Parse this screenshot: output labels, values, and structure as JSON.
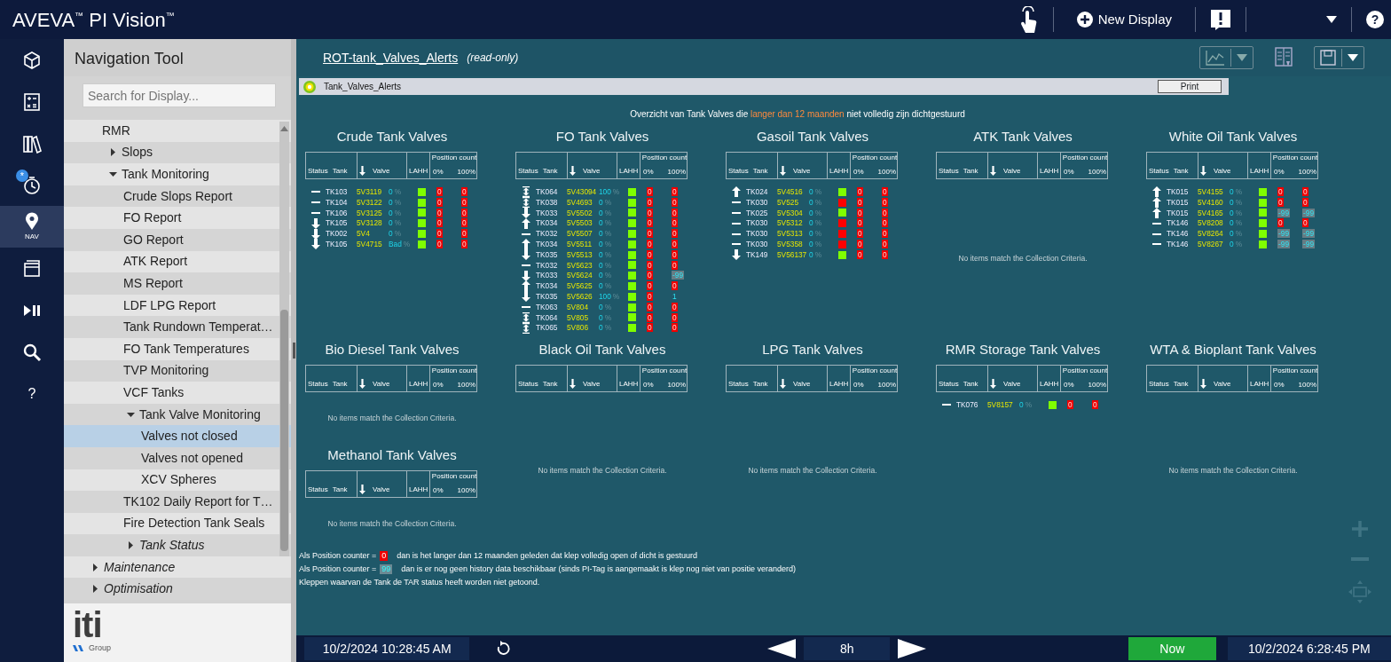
{
  "app": {
    "title": "AVEVA$^{™}$ PI Vision$^{™}$",
    "new_display": "New Display",
    "help": "?"
  },
  "rail": [
    {
      "kind": "cube",
      "selected": false
    },
    {
      "kind": "calculator",
      "selected": false
    },
    {
      "kind": "library",
      "selected": false
    },
    {
      "kind": "clock",
      "badge": "*",
      "selected": false
    },
    {
      "kind": "nav",
      "label": "NAV",
      "selected": true
    },
    {
      "kind": "screens",
      "selected": false
    },
    {
      "kind": "play",
      "selected": false
    },
    {
      "kind": "search",
      "selected": false
    },
    {
      "kind": "help",
      "label": "?",
      "selected": false
    }
  ],
  "navigation": {
    "title": "Navigation Tool",
    "search": {
      "placeholder": "Search for Display..."
    },
    "tree": [
      {
        "label": "RMR",
        "kind": "folder",
        "selected": false,
        "children": [
          {
            "label": "Slops",
            "kind": "folder",
            "expanded": false,
            "selected": false
          },
          {
            "label": "Tank Monitoring",
            "kind": "folder",
            "expanded": true,
            "selected": false,
            "children": [
              {
                "label": "Crude Slops Report",
                "kind": "display",
                "selected": false
              },
              {
                "label": "FO Report",
                "kind": "display",
                "selected": false
              },
              {
                "label": "GO Report",
                "kind": "display",
                "selected": false
              },
              {
                "label": "ATK Report",
                "kind": "display",
                "selected": false
              },
              {
                "label": "MS Report",
                "kind": "display",
                "selected": false
              },
              {
                "label": "LDF LPG Report",
                "kind": "display",
                "selected": false
              },
              {
                "label": "Tank Rundown Temperat…",
                "kind": "display",
                "selected": false
              },
              {
                "label": "FO Tank Temperatures",
                "kind": "display",
                "selected": false
              },
              {
                "label": "TVP Monitoring",
                "kind": "display",
                "selected": false
              },
              {
                "label": "VCF Tanks",
                "kind": "display",
                "selected": false
              },
              {
                "label": "Tank Valve Monitoring",
                "kind": "folder",
                "expanded": true,
                "selected": false,
                "children": [
                  {
                    "label": "Valves not closed",
                    "kind": "display",
                    "selected": true
                  },
                  {
                    "label": "Valves not opened",
                    "kind": "display",
                    "selected": false
                  },
                  {
                    "label": "XCV Spheres",
                    "kind": "display",
                    "selected": false
                  }
                ]
              },
              {
                "label": "TK102 Daily Report for T…",
                "kind": "display",
                "selected": false
              },
              {
                "label": "Fire Detection Tank Seals",
                "kind": "display",
                "selected": false
              },
              {
                "label": "Tank Status",
                "kind": "category",
                "expanded": false,
                "selected": false
              }
            ]
          }
        ]
      },
      {
        "label": "Maintenance",
        "kind": "category",
        "expanded": false,
        "selected": false
      },
      {
        "label": "Optimisation",
        "kind": "category",
        "expanded": false,
        "selected": false
      }
    ],
    "logo": "iti",
    "logo_sub": "Group"
  },
  "display_header": {
    "name": "ROT-tank_Valves_Alerts",
    "mode": "(read-only)"
  },
  "display_bar": {
    "title": "Tank_Valves_Alerts",
    "print": "Print"
  },
  "headline": {
    "before": "Overzicht van Tank Valves die",
    "highlight": "langer dan 12 maanden",
    "after": "niet volledig zijn dichtgestuurd"
  },
  "panels": [
    {
      "title": "Crude Tank Valves",
      "header": {
        "status": "Status",
        "tank": "Tank",
        "valve": "Valve",
        "lahh": "LAHH",
        "group": "Position count",
        "low": "0%",
        "high": "100%"
      },
      "rows": [
        {
          "kind": "none",
          "tank": "TK103",
          "valve": "5V3119",
          "value": "0",
          "unit": "%",
          "lahh_alarm": false,
          "counts": [
            {
              "text": "0",
              "kind": "alarm"
            },
            {
              "text": "0",
              "kind": "alarm"
            }
          ]
        },
        {
          "kind": "none",
          "tank": "TK104",
          "valve": "5V3122",
          "value": "0",
          "unit": "%",
          "lahh_alarm": false,
          "counts": [
            {
              "text": "0",
              "kind": "alarm"
            },
            {
              "text": "0",
              "kind": "alarm"
            }
          ]
        },
        {
          "kind": "none",
          "tank": "TK106",
          "valve": "5V3125",
          "value": "0",
          "unit": "%",
          "lahh_alarm": false,
          "counts": [
            {
              "text": "0",
              "kind": "alarm"
            },
            {
              "text": "0",
              "kind": "alarm"
            }
          ]
        },
        {
          "kind": "down",
          "tank": "TK105",
          "valve": "5V3128",
          "value": "0",
          "unit": "%",
          "lahh_alarm": false,
          "counts": [
            {
              "text": "0",
              "kind": "alarm"
            },
            {
              "text": "0",
              "kind": "alarm"
            }
          ]
        },
        {
          "kind": "down",
          "tank": "TK002",
          "valve": "5V4",
          "value": "0",
          "unit": "%",
          "lahh_alarm": false,
          "counts": [
            {
              "text": "0",
              "kind": "alarm"
            },
            {
              "text": "0",
              "kind": "alarm"
            }
          ]
        },
        {
          "kind": "down",
          "tank": "TK105",
          "valve": "5V4715",
          "value": "Bad",
          "unit": "%",
          "lahh_alarm": false,
          "counts": [
            {
              "text": "0",
              "kind": "alarm"
            },
            {
              "text": "0",
              "kind": "alarm"
            }
          ]
        }
      ]
    },
    {
      "title": "FO Tank Valves",
      "header": {
        "status": "Status",
        "tank": "Tank",
        "valve": "Valve",
        "lahh": "LAHH",
        "group": "Position count",
        "low": "0%",
        "high": "100%"
      },
      "rows": [
        {
          "kind": "both",
          "tank": "TK064",
          "valve": "5V43094",
          "value": "100",
          "unit": "%",
          "lahh_alarm": false,
          "counts": [
            {
              "text": "0",
              "kind": "alarm"
            },
            {
              "text": "0",
              "kind": "alarm"
            }
          ]
        },
        {
          "kind": "both",
          "tank": "TK038",
          "valve": "5V4693",
          "value": "0",
          "unit": "%",
          "lahh_alarm": false,
          "counts": [
            {
              "text": "0",
              "kind": "alarm"
            },
            {
              "text": "0",
              "kind": "alarm"
            }
          ]
        },
        {
          "kind": "down",
          "tank": "TK033",
          "valve": "5V5502",
          "value": "0",
          "unit": "%",
          "lahh_alarm": false,
          "counts": [
            {
              "text": "0",
              "kind": "alarm"
            },
            {
              "text": "0",
              "kind": "alarm"
            }
          ]
        },
        {
          "kind": "up",
          "tank": "TK034",
          "valve": "5V5503",
          "value": "0",
          "unit": "%",
          "lahh_alarm": false,
          "counts": [
            {
              "text": "0",
              "kind": "alarm"
            },
            {
              "text": "0",
              "kind": "alarm"
            }
          ]
        },
        {
          "kind": "none",
          "tank": "TK032",
          "valve": "5V5507",
          "value": "0",
          "unit": "%",
          "lahh_alarm": false,
          "counts": [
            {
              "text": "0",
              "kind": "alarm"
            },
            {
              "text": "0",
              "kind": "alarm"
            }
          ]
        },
        {
          "kind": "up",
          "tank": "TK034",
          "valve": "5V5511",
          "value": "0",
          "unit": "%",
          "lahh_alarm": false,
          "counts": [
            {
              "text": "0",
              "kind": "alarm"
            },
            {
              "text": "0",
              "kind": "alarm"
            }
          ]
        },
        {
          "kind": "down",
          "tank": "TK035",
          "valve": "5V5513",
          "value": "0",
          "unit": "%",
          "lahh_alarm": false,
          "counts": [
            {
              "text": "0",
              "kind": "alarm"
            },
            {
              "text": "0",
              "kind": "alarm"
            }
          ]
        },
        {
          "kind": "none",
          "tank": "TK032",
          "valve": "5V5623",
          "value": "0",
          "unit": "%",
          "lahh_alarm": false,
          "counts": [
            {
              "text": "0",
              "kind": "alarm"
            },
            {
              "text": "0",
              "kind": "alarm"
            }
          ]
        },
        {
          "kind": "down",
          "tank": "TK033",
          "valve": "5V5624",
          "value": "0",
          "unit": "%",
          "lahh_alarm": false,
          "counts": [
            {
              "text": "0",
              "kind": "alarm"
            },
            {
              "text": "-99",
              "kind": "nodata"
            }
          ]
        },
        {
          "kind": "up",
          "tank": "TK034",
          "valve": "5V5625",
          "value": "0",
          "unit": "%",
          "lahh_alarm": false,
          "counts": [
            {
              "text": "0",
              "kind": "alarm"
            },
            {
              "text": "0",
              "kind": "alarm"
            }
          ]
        },
        {
          "kind": "down",
          "tank": "TK035",
          "valve": "5V5626",
          "value": "100",
          "unit": "%",
          "lahh_alarm": false,
          "counts": [
            {
              "text": "0",
              "kind": "alarm"
            },
            {
              "text": "1",
              "kind": "plain"
            }
          ]
        },
        {
          "kind": "none",
          "tank": "TK063",
          "valve": "5V804",
          "value": "0",
          "unit": "%",
          "lahh_alarm": false,
          "counts": [
            {
              "text": "0",
              "kind": "alarm"
            },
            {
              "text": "0",
              "kind": "alarm"
            }
          ]
        },
        {
          "kind": "both",
          "tank": "TK064",
          "valve": "5V805",
          "value": "0",
          "unit": "%",
          "lahh_alarm": false,
          "counts": [
            {
              "text": "0",
              "kind": "alarm"
            },
            {
              "text": "0",
              "kind": "alarm"
            }
          ]
        },
        {
          "kind": "both",
          "tank": "TK065",
          "valve": "5V806",
          "value": "0",
          "unit": "%",
          "lahh_alarm": false,
          "counts": [
            {
              "text": "0",
              "kind": "alarm"
            },
            {
              "text": "0",
              "kind": "alarm"
            }
          ]
        }
      ]
    },
    {
      "title": "Gasoil Tank Valves",
      "header": {
        "status": "Status",
        "tank": "Tank",
        "valve": "Valve",
        "lahh": "LAHH",
        "group": "Position count",
        "low": "0%",
        "high": "100%"
      },
      "rows": [
        {
          "kind": "up",
          "tank": "TK024",
          "valve": "5V4516",
          "value": "0",
          "unit": "%",
          "lahh_alarm": false,
          "counts": [
            {
              "text": "0",
              "kind": "alarm"
            },
            {
              "text": "0",
              "kind": "alarm"
            }
          ]
        },
        {
          "kind": "none",
          "tank": "TK030",
          "valve": "5V525",
          "value": "0",
          "unit": "%",
          "lahh_alarm": true,
          "counts": [
            {
              "text": "0",
              "kind": "alarm"
            },
            {
              "text": "0",
              "kind": "alarm"
            }
          ]
        },
        {
          "kind": "none",
          "tank": "TK025",
          "valve": "5V5304",
          "value": "0",
          "unit": "%",
          "lahh_alarm": false,
          "counts": [
            {
              "text": "0",
              "kind": "alarm"
            },
            {
              "text": "0",
              "kind": "alarm"
            }
          ]
        },
        {
          "kind": "none",
          "tank": "TK030",
          "valve": "5V5312",
          "value": "0",
          "unit": "%",
          "lahh_alarm": true,
          "counts": [
            {
              "text": "0",
              "kind": "alarm"
            },
            {
              "text": "0",
              "kind": "alarm"
            }
          ]
        },
        {
          "kind": "none",
          "tank": "TK030",
          "valve": "5V5313",
          "value": "0",
          "unit": "%",
          "lahh_alarm": true,
          "counts": [
            {
              "text": "0",
              "kind": "alarm"
            },
            {
              "text": "0",
              "kind": "alarm"
            }
          ]
        },
        {
          "kind": "none",
          "tank": "TK030",
          "valve": "5V5358",
          "value": "0",
          "unit": "%",
          "lahh_alarm": true,
          "counts": [
            {
              "text": "0",
              "kind": "alarm"
            },
            {
              "text": "0",
              "kind": "alarm"
            }
          ]
        },
        {
          "kind": "down",
          "tank": "TK149",
          "valve": "5V56137",
          "value": "0",
          "unit": "%",
          "lahh_alarm": false,
          "counts": [
            {
              "text": "0",
              "kind": "alarm"
            },
            {
              "text": "0",
              "kind": "alarm"
            }
          ]
        }
      ]
    },
    {
      "title": "ATK Tank Valves",
      "header": {
        "status": "Status",
        "tank": "Tank",
        "valve": "Valve",
        "lahh": "LAHH",
        "group": "Position count",
        "low": "0%",
        "high": "100%"
      },
      "empty_message": "No items match the Collection Criteria."
    },
    {
      "title": "White Oil Tank Valves",
      "header": {
        "status": "Status",
        "tank": "Tank",
        "valve": "Valve",
        "lahh": "LAHH",
        "group": "Position count",
        "low": "0%",
        "high": "100%"
      },
      "rows": [
        {
          "kind": "up",
          "tank": "TK015",
          "valve": "5V4155",
          "value": "0",
          "unit": "%",
          "lahh_alarm": false,
          "counts": [
            {
              "text": "0",
              "kind": "alarm"
            },
            {
              "text": "0",
              "kind": "alarm"
            }
          ]
        },
        {
          "kind": "up",
          "tank": "TK015",
          "valve": "5V4160",
          "value": "0",
          "unit": "%",
          "lahh_alarm": false,
          "counts": [
            {
              "text": "0",
              "kind": "alarm"
            },
            {
              "text": "0",
              "kind": "alarm"
            }
          ]
        },
        {
          "kind": "up",
          "tank": "TK015",
          "valve": "5V4165",
          "value": "0",
          "unit": "%",
          "lahh_alarm": false,
          "counts": [
            {
              "text": "-99",
              "kind": "nodata"
            },
            {
              "text": "-99",
              "kind": "nodata"
            }
          ]
        },
        {
          "kind": "none",
          "tank": "TK146",
          "valve": "5V8208",
          "value": "0",
          "unit": "%",
          "lahh_alarm": false,
          "counts": [
            {
              "text": "0",
              "kind": "alarm"
            },
            {
              "text": "0",
              "kind": "alarm"
            }
          ]
        },
        {
          "kind": "none",
          "tank": "TK146",
          "valve": "5V8264",
          "value": "0",
          "unit": "%",
          "lahh_alarm": false,
          "counts": [
            {
              "text": "-99",
              "kind": "nodata"
            },
            {
              "text": "-99",
              "kind": "nodata"
            }
          ]
        },
        {
          "kind": "none",
          "tank": "TK146",
          "valve": "5V8267",
          "value": "0",
          "unit": "%",
          "lahh_alarm": false,
          "counts": [
            {
              "text": "-99",
              "kind": "nodata"
            },
            {
              "text": "-99",
              "kind": "nodata"
            }
          ]
        }
      ]
    },
    {
      "title": "Bio Diesel Tank Valves",
      "header": {
        "status": "Status",
        "tank": "Tank",
        "valve": "Valve",
        "lahh": "LAHH",
        "group": "Position count",
        "low": "0%",
        "high": "100%"
      },
      "empty_message": "No items match the Collection Criteria."
    },
    {
      "title": "Black Oil Tank Valves",
      "header": {
        "status": "Status",
        "tank": "Tank",
        "valve": "Valve",
        "lahh": "LAHH",
        "group": "Position count",
        "low": "0%",
        "high": "100%"
      },
      "empty_message": "No items match the Collection Criteria."
    },
    {
      "title": "LPG Tank Valves",
      "header": {
        "status": "Status",
        "tank": "Tank",
        "valve": "Valve",
        "lahh": "LAHH",
        "group": "Position count",
        "low": "0%",
        "high": "100%"
      },
      "empty_message": "No items match the Collection Criteria."
    },
    {
      "title": "RMR Storage Tank Valves",
      "header": {
        "status": "Status",
        "tank": "Tank",
        "valve": "Valve",
        "lahh": "LAHH",
        "group": "Position count",
        "low": "0%",
        "high": "100%"
      },
      "rows": [
        {
          "kind": "none",
          "tank": "TK076",
          "valve": "5V8157",
          "value": "0",
          "unit": "%",
          "lahh_alarm": false,
          "counts": [
            {
              "text": "0",
              "kind": "alarm"
            },
            {
              "text": "0",
              "kind": "alarm"
            }
          ]
        }
      ]
    },
    {
      "title": "WTA & Bioplant Tank Valves",
      "header": {
        "status": "Status",
        "tank": "Tank",
        "valve": "Valve",
        "lahh": "LAHH",
        "group": "Position count",
        "low": "0%",
        "high": "100%"
      },
      "empty_message": "No items match the Collection Criteria."
    },
    {
      "title": "Methanol Tank Valves",
      "header": {
        "status": "Status",
        "tank": "Tank",
        "valve": "Valve",
        "lahh": "LAHH",
        "group": "Position count",
        "low": "0%",
        "high": "100%"
      },
      "empty_message": "No items match the Collection Criteria."
    }
  ],
  "notes": [
    {
      "before": "Als Position counter =",
      "badge": {
        "text": "0",
        "kind": "alarm"
      },
      "after": "dan is het langer dan 12 maanden geleden dat klep volledig open of dicht is gestuurd"
    },
    {
      "before": "Als Position counter =",
      "badge": {
        "text": "99",
        "kind": "nodata"
      },
      "after": "dan is er nog geen history data beschikbaar (sinds PI-Tag is aangemaakt is klep nog niet van positie veranderd)"
    },
    {
      "before": "Kleppen waarvan de Tank de TAR  status heeft worden niet getoond."
    }
  ],
  "time_bar": {
    "start": "10/2/2024 10:28:45 AM",
    "duration": "8h",
    "now": "Now",
    "end": "10/2/2024 6:28:45 PM"
  }
}
